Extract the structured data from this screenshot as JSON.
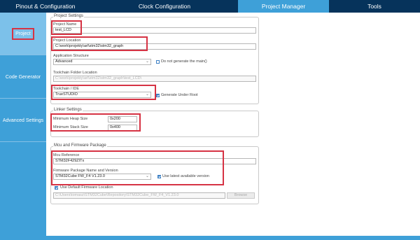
{
  "tabs": [
    {
      "label": "Pinout & Configuration"
    },
    {
      "label": "Clock Configuration"
    },
    {
      "label": "Project Manager"
    },
    {
      "label": "Tools"
    }
  ],
  "sidebar": {
    "items": [
      {
        "label": "Project"
      },
      {
        "label": "Code Generator"
      },
      {
        "label": "Advanced Settings"
      }
    ]
  },
  "project_settings": {
    "title": "Project Settings",
    "project_name_label": "Project Name",
    "project_name_value": "test_LCD",
    "project_location_label": "Project Location",
    "project_location_value": "C:\\work\\projekty\\arl\\stm32\\stm32_graph",
    "app_structure_label": "Application Structure",
    "app_structure_value": "Advanced",
    "do_not_generate_main_label": "Do not generate the main()",
    "toolchain_folder_label": "Toolchain Folder Location",
    "toolchain_folder_value": "C:\\work\\projekty\\arl\\stm32\\stm32_graph\\test_LCD\\",
    "toolchain_ide_label": "Toolchain / IDE",
    "toolchain_ide_value": "TrueSTUDIO",
    "generate_under_root_label": "Generate Under Root"
  },
  "linker_settings": {
    "title": "Linker Settings",
    "min_heap_label": "Minimum Heap Size",
    "min_heap_value": "0x200",
    "min_stack_label": "Minimum Stack Size",
    "min_stack_value": "0x400"
  },
  "mcu_firmware": {
    "title": "Mcu and Firmware Package",
    "mcu_reference_label": "Mcu Reference",
    "mcu_reference_value": "STM32F429ZITx",
    "firmware_package_label": "Firmware Package Name and Version",
    "firmware_package_value": "STM32Cube FW_F4 V1.23.0",
    "use_latest_label": "Use latest available version",
    "use_default_location_label": "Use Default Firmware Location",
    "firmware_location_value": "C:\\Users\\tomasz\\STM32Cube\\Repository\\STM32Cube_FW_F4_V1.23.0",
    "browse_label": "Browse"
  },
  "colors": {
    "navy": "#06335b",
    "accent_blue": "#3ea0d8",
    "highlight_red": "#d63344"
  }
}
